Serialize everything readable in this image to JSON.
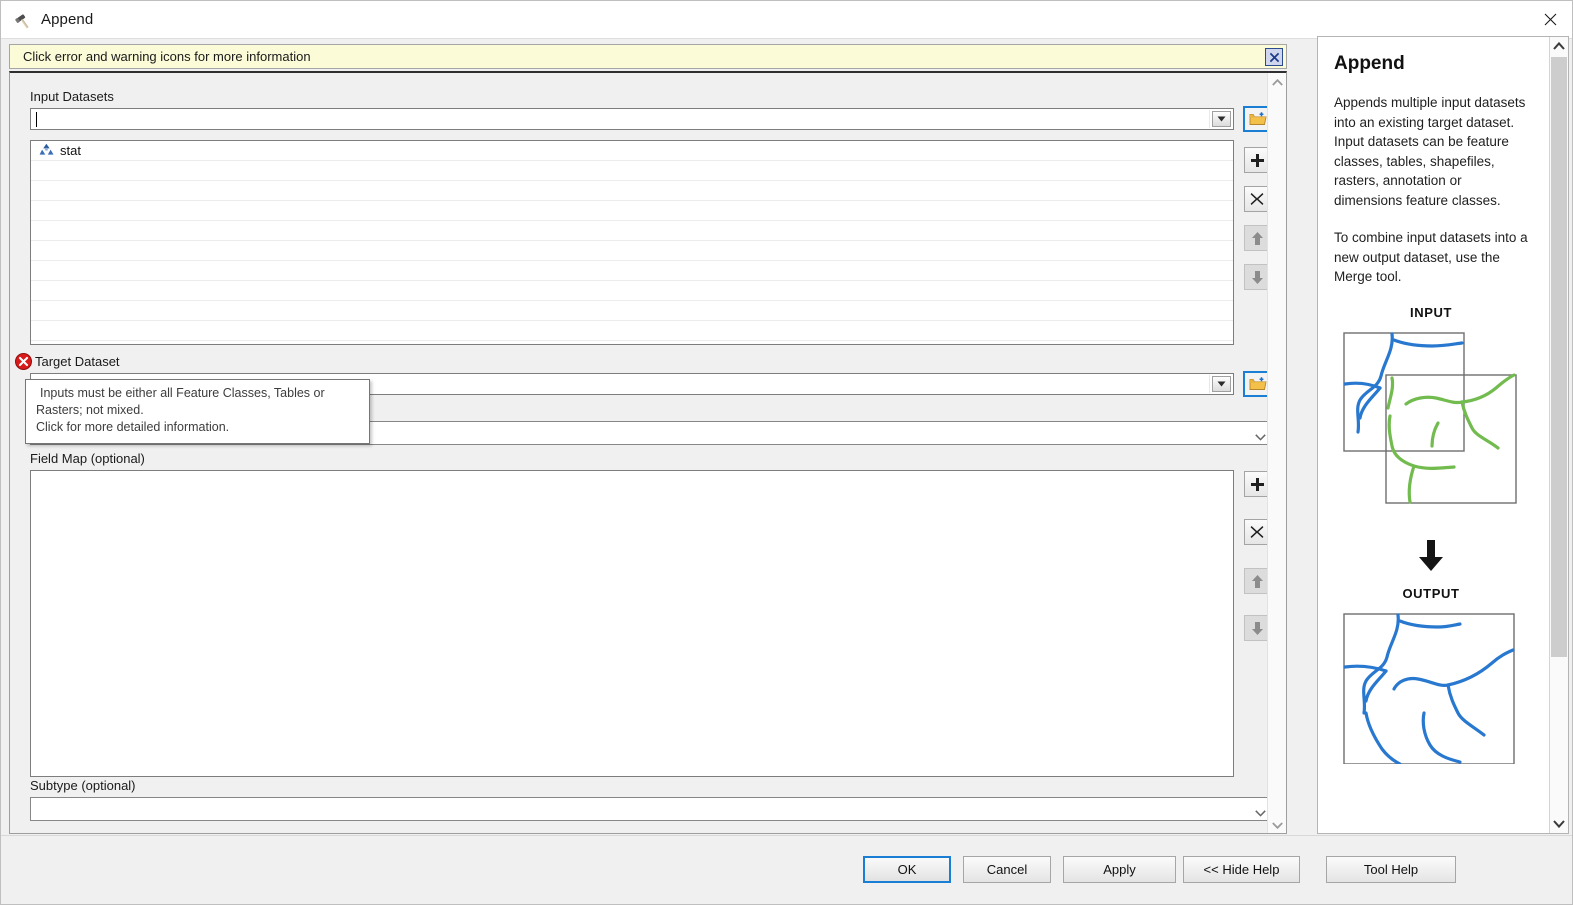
{
  "window": {
    "title": "Append",
    "icon": "hammer-tool-icon",
    "close_label": "✕"
  },
  "warning_bar": {
    "message": "Click error and warning icons for more information",
    "close_label": "✕",
    "background": "#fcfbd8"
  },
  "parameters": {
    "input_datasets": {
      "label": "Input Datasets",
      "value": "",
      "placeholder": "",
      "browse_icon": "open-folder-add-icon",
      "list_items": [
        {
          "label": "stat",
          "icon": "feature-class-polygon-icon"
        }
      ],
      "tools": [
        {
          "name": "add-button",
          "icon": "plus-icon",
          "enabled": true
        },
        {
          "name": "remove-button",
          "icon": "x-icon",
          "enabled": true
        },
        {
          "name": "move-up-button",
          "icon": "arrow-up-icon",
          "enabled": false
        },
        {
          "name": "move-down-button",
          "icon": "arrow-down-icon",
          "enabled": false
        }
      ]
    },
    "target_dataset": {
      "label": "Target Dataset",
      "value": "",
      "error_icon": "error-circle-icon",
      "error_color": "#d91b1b",
      "browse_icon": "open-folder-add-icon"
    },
    "schema_type": {
      "label": "",
      "value": ""
    },
    "field_map": {
      "label": "Field Map (optional)",
      "value": "",
      "tools": [
        {
          "name": "add-button",
          "icon": "plus-icon",
          "enabled": true
        },
        {
          "name": "remove-button",
          "icon": "x-icon",
          "enabled": true
        },
        {
          "name": "move-up-button",
          "icon": "arrow-up-icon",
          "enabled": false
        },
        {
          "name": "move-down-button",
          "icon": "arrow-down-icon",
          "enabled": false
        }
      ]
    },
    "subtype": {
      "label": "Subtype (optional)",
      "value": ""
    }
  },
  "tooltip": {
    "line1": "Inputs must be either all Feature Classes, Tables or",
    "line2": "Rasters; not mixed.",
    "line3": "Click for more detailed information."
  },
  "help": {
    "title": "Append",
    "paragraph1": "Appends multiple input datasets into an existing target dataset. Input datasets can be feature classes, tables, shapefiles, rasters, annotation or dimensions feature classes.",
    "paragraph2": "To combine input datasets into a new output dataset, use the Merge tool.",
    "diagram": {
      "input_label": "INPUT",
      "output_label": "OUTPUT",
      "arrow_icon": "arrow-down-icon",
      "line_color_a": "#2878d0",
      "line_color_b": "#72bb4e"
    }
  },
  "footer": {
    "ok": "OK",
    "cancel": "Cancel",
    "apply": "Apply",
    "hide_help": "<< Hide Help",
    "tool_help": "Tool Help"
  },
  "scrollbars": {
    "main_panel": "vertical-scrollbar",
    "help_panel": "vertical-scrollbar"
  }
}
